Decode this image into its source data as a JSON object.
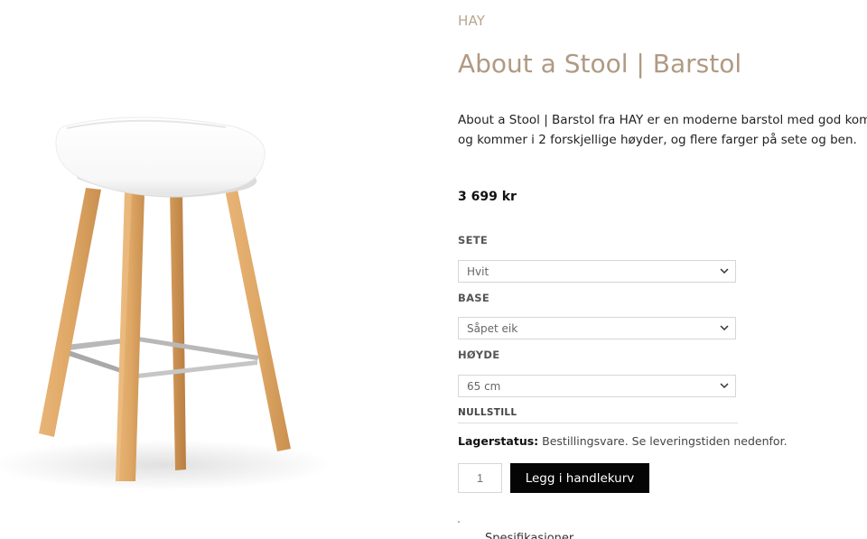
{
  "product": {
    "brand": "HAY",
    "title": "About a Stool | Barstol",
    "description_lines": [
      "About a Stool | Barstol fra HAY er en moderne barstol med god komfort.",
      "og kommer i 2 forskjellige høyder, og flere farger på sete og ben."
    ],
    "price": "3 699 kr",
    "image_alt": "About a Stool barstol"
  },
  "options": [
    {
      "label": "SETE",
      "selected": "Hvit"
    },
    {
      "label": "BASE",
      "selected": "Såpet eik"
    },
    {
      "label": "HØYDE",
      "selected": "65 cm"
    }
  ],
  "reset_label": "NULLSTILL",
  "stock": {
    "label": "Lagerstatus:",
    "value": "Bestillingsvare. Se leveringstiden nedenfor."
  },
  "cart": {
    "quantity": "1",
    "button_label": "Legg i handlekurv"
  },
  "below_fold": {
    "partial_text": "Spesifikasjoner"
  },
  "colors": {
    "brand": "#b9a58f",
    "title": "#b09a83",
    "button_bg": "#050505",
    "button_text": "#ffffff",
    "wood": "#dfa866",
    "seat": "#ffffff",
    "footrest": "#b8b8b8"
  },
  "icons": {
    "select_arrow": "chevron-down-icon"
  }
}
